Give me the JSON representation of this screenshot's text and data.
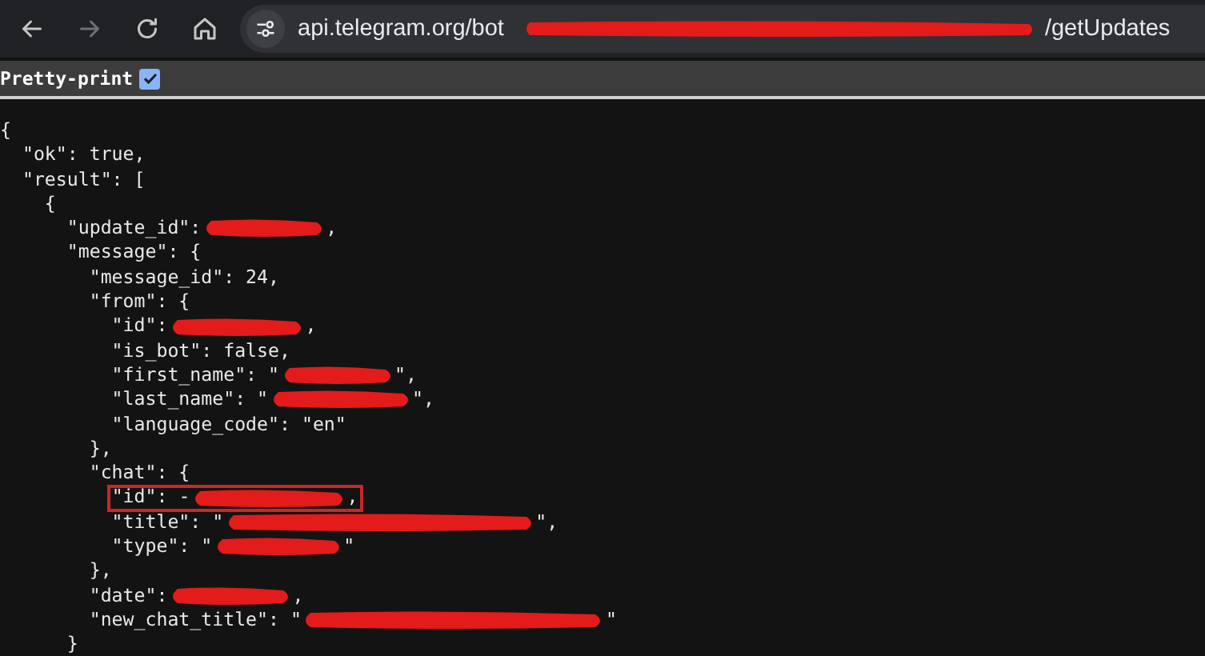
{
  "toolbar": {
    "url_start": "api.telegram.org/bot",
    "url_end": "/getUpdates"
  },
  "pretty_print": {
    "label": "Pretty-print",
    "checked": true
  },
  "lines": [
    {
      "parts": [
        {
          "kind": "text",
          "text": "{"
        }
      ]
    },
    {
      "parts": [
        {
          "kind": "text",
          "text": "  \"ok\": true,"
        }
      ]
    },
    {
      "parts": [
        {
          "kind": "text",
          "text": "  \"result\": ["
        }
      ]
    },
    {
      "parts": [
        {
          "kind": "text",
          "text": "    {"
        }
      ]
    },
    {
      "parts": [
        {
          "kind": "text",
          "text": "      \"update_id\":"
        },
        {
          "kind": "redaction"
        },
        {
          "kind": "text",
          "text": ","
        }
      ]
    },
    {
      "parts": [
        {
          "kind": "text",
          "text": "      \"message\": {"
        }
      ]
    },
    {
      "parts": [
        {
          "kind": "text",
          "text": "        \"message_id\": 24,"
        }
      ]
    },
    {
      "parts": [
        {
          "kind": "text",
          "text": "        \"from\": {"
        }
      ]
    },
    {
      "parts": [
        {
          "kind": "text",
          "text": "          \"id\":"
        },
        {
          "kind": "redaction"
        },
        {
          "kind": "text",
          "text": ","
        }
      ]
    },
    {
      "parts": [
        {
          "kind": "text",
          "text": "          \"is_bot\": false,"
        }
      ]
    },
    {
      "parts": [
        {
          "kind": "text",
          "text": "          \"first_name\": \""
        },
        {
          "kind": "redaction"
        },
        {
          "kind": "text",
          "text": "\","
        }
      ]
    },
    {
      "parts": [
        {
          "kind": "text",
          "text": "          \"last_name\": \""
        },
        {
          "kind": "redaction"
        },
        {
          "kind": "text",
          "text": "\","
        }
      ]
    },
    {
      "parts": [
        {
          "kind": "text",
          "text": "          \"language_code\": \"en\""
        }
      ]
    },
    {
      "parts": [
        {
          "kind": "text",
          "text": "        },"
        }
      ]
    },
    {
      "parts": [
        {
          "kind": "text",
          "text": "        \"chat\": {"
        }
      ]
    },
    {
      "boxed": true,
      "parts": [
        {
          "kind": "text",
          "text": "          \"id\": -"
        },
        {
          "kind": "redaction"
        },
        {
          "kind": "text",
          "text": ","
        }
      ]
    },
    {
      "parts": [
        {
          "kind": "text",
          "text": "          \"title\": \""
        },
        {
          "kind": "redaction"
        },
        {
          "kind": "text",
          "text": "\","
        }
      ]
    },
    {
      "parts": [
        {
          "kind": "text",
          "text": "          \"type\": \""
        },
        {
          "kind": "redaction"
        },
        {
          "kind": "text",
          "text": "\""
        }
      ]
    },
    {
      "parts": [
        {
          "kind": "text",
          "text": "        },"
        }
      ]
    },
    {
      "parts": [
        {
          "kind": "text",
          "text": "        \"date\":"
        },
        {
          "kind": "redaction"
        },
        {
          "kind": "text",
          "text": ","
        }
      ]
    },
    {
      "parts": [
        {
          "kind": "text",
          "text": "        \"new_chat_title\": \""
        },
        {
          "kind": "redaction"
        },
        {
          "kind": "text",
          "text": "\""
        }
      ]
    },
    {
      "parts": [
        {
          "kind": "text",
          "text": "      }"
        }
      ]
    }
  ]
}
